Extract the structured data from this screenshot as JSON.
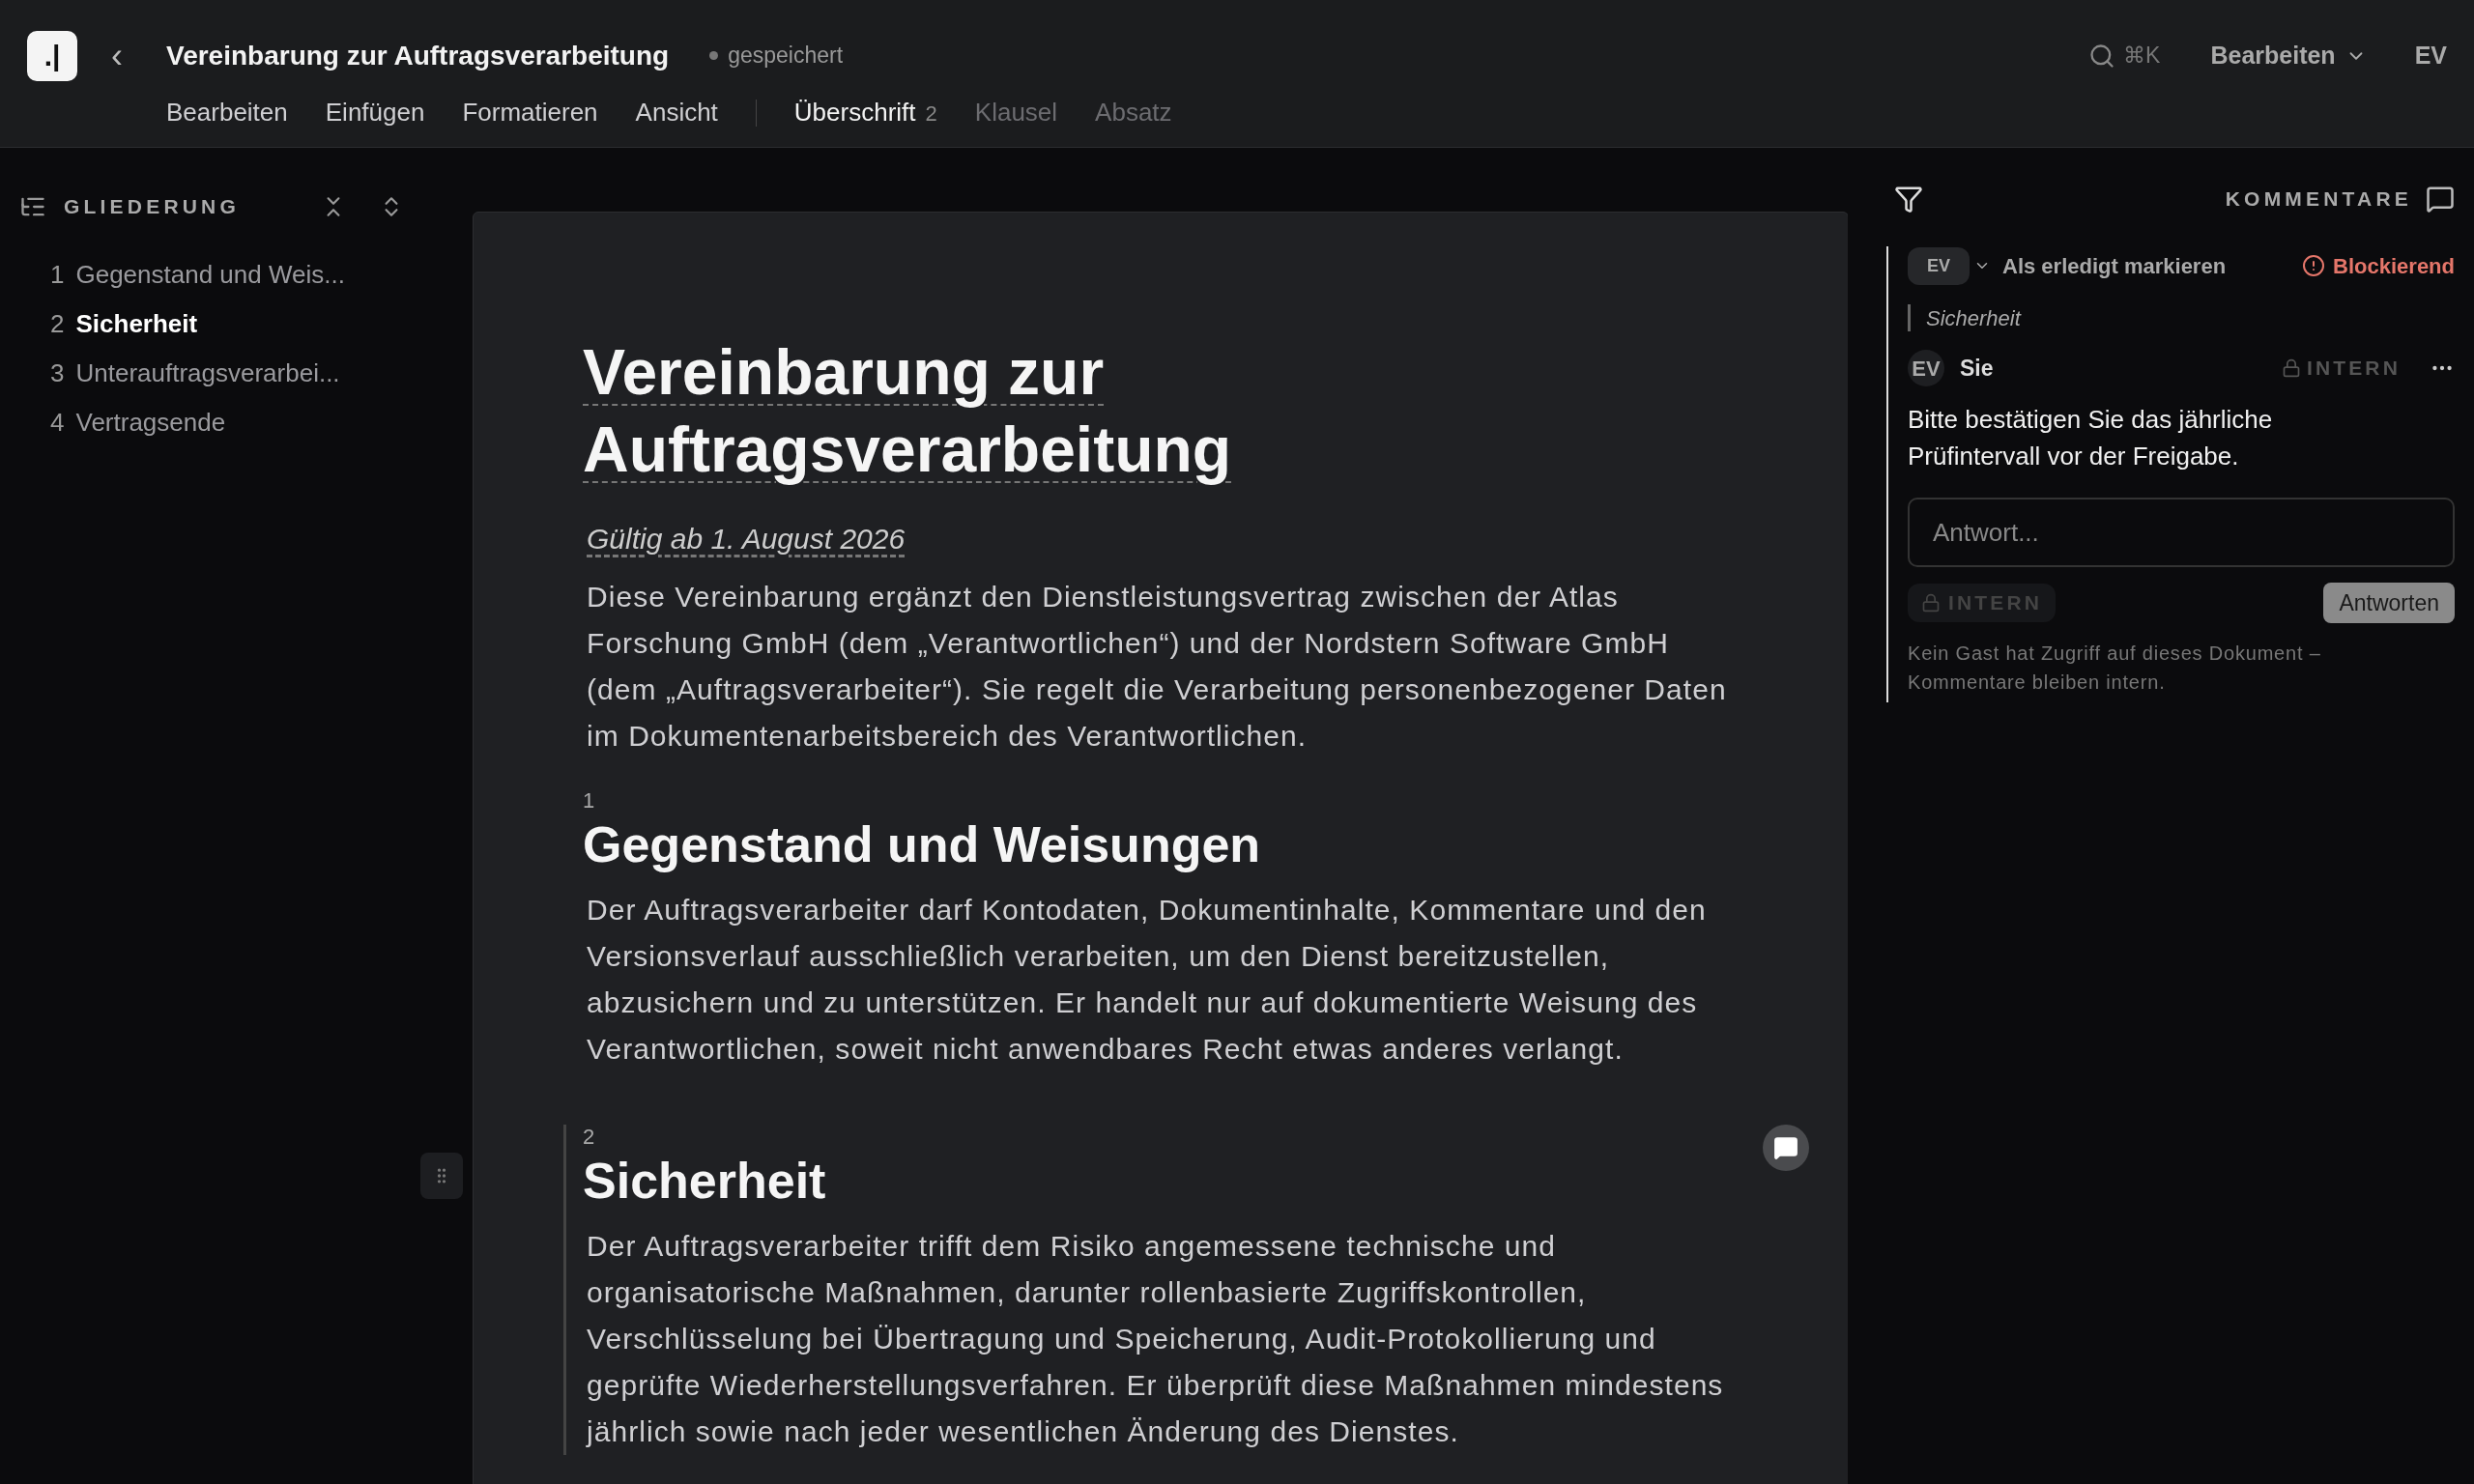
{
  "app": {
    "logo": ".|",
    "back": "‹"
  },
  "header": {
    "title": "Vereinbarung zur Auftragsverarbeitung",
    "save_status": "gespeichert",
    "search_shortcut": "⌘K",
    "mode_button": "Bearbeiten",
    "user": "EV"
  },
  "menus": [
    "Bearbeiten",
    "Einfügen",
    "Formatieren",
    "Ansicht"
  ],
  "block_types": [
    {
      "label": "Überschrift",
      "badge": "2",
      "selected": true
    },
    {
      "label": "Klausel",
      "selected": false
    },
    {
      "label": "Absatz",
      "selected": false
    }
  ],
  "outline": {
    "title": "GLIEDERUNG",
    "items": [
      {
        "number": "1",
        "label": "Gegenstand und Weis...",
        "selected": false
      },
      {
        "number": "2",
        "label": "Sicherheit",
        "selected": true
      },
      {
        "number": "3",
        "label": "Unterauftragsverarbei...",
        "selected": false
      },
      {
        "number": "4",
        "label": "Vertragsende",
        "selected": false
      }
    ]
  },
  "document": {
    "title_lines": [
      "Vereinbarung zur",
      "Auftragsverarbeitung"
    ],
    "effective": "Gültig ab 1. August 2026",
    "intro": "Diese Vereinbarung ergänzt den Dienstleistungsvertrag zwischen der Atlas Forschung GmbH (dem „Verantwortlichen“) und der Nordstern Software GmbH (dem „Auftragsverarbeiter“). Sie regelt die Verarbeitung personenbezogener Daten im Dokumentenarbeitsbereich des Verantwortlichen.",
    "sections": [
      {
        "number": "1",
        "heading": "Gegenstand und Weisungen",
        "body": "Der Auftragsverarbeiter darf Kontodaten, Dokumentinhalte, Kommentare und den Versionsverlauf ausschließlich verarbeiten, um den Dienst bereitzustellen, abzusichern und zu unterstützen. Er handelt nur auf dokumentierte Weisung des Verantwortlichen, soweit nicht anwendbares Recht etwas anderes verlangt.",
        "selected": false
      },
      {
        "number": "2",
        "heading": "Sicherheit",
        "body": "Der Auftragsverarbeiter trifft dem Risiko angemessene technische und organisatorische Maßnahmen, darunter rollenbasierte Zugriffskontrollen, Verschlüsselung bei Übertragung und Speicherung, Audit-Protokollierung und geprüfte Wiederherstellungsverfahren. Er überprüft diese Maßnahmen mindestens jährlich sowie nach jeder wesentlichen Änderung des Dienstes.",
        "selected": true
      }
    ]
  },
  "comments": {
    "title": "KOMMENTARE",
    "thread": {
      "assignee": "EV",
      "resolve": "Als erledigt markieren",
      "priority": "Blockierend",
      "quote": "Sicherheit",
      "author_avatar": "EV",
      "author": "Sie",
      "visibility": "INTERN",
      "text": "Bitte bestätigen Sie das jährliche Prüfintervall vor der Freigabe.",
      "reply": {
        "placeholder": "Antwort...",
        "internal_toggle": "INTERN",
        "internal": false,
        "button": "Antworten"
      },
      "note": "Kein Gast hat Zugriff auf dieses Dokument – Kommentare bleiben intern."
    }
  }
}
